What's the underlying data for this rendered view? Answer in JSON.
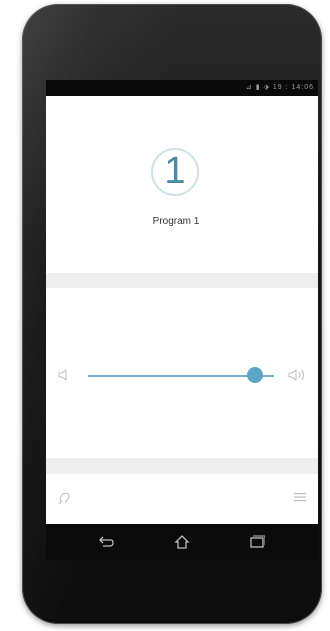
{
  "status_bar": {
    "icons": [
      "bluetooth-icon",
      "signal-icon",
      "battery-icon"
    ],
    "text": "⊿ ▮ ⬗ 19 : 14:06"
  },
  "program": {
    "number": "1",
    "label": "Program 1"
  },
  "volume": {
    "level": 0.9,
    "low_icon": "volume-low-icon",
    "high_icon": "volume-high-icon"
  },
  "bottom_bar": {
    "left_icon": "hearing-icon",
    "right_icon": "menu-icon"
  },
  "nav_bar": {
    "icons": [
      "back-icon",
      "home-icon",
      "recent-apps-icon"
    ]
  },
  "colors": {
    "accent": "#5aa6c4",
    "circle_border": "#cfe0e6",
    "divider": "#eeeeee",
    "phone_body": "#151515"
  }
}
